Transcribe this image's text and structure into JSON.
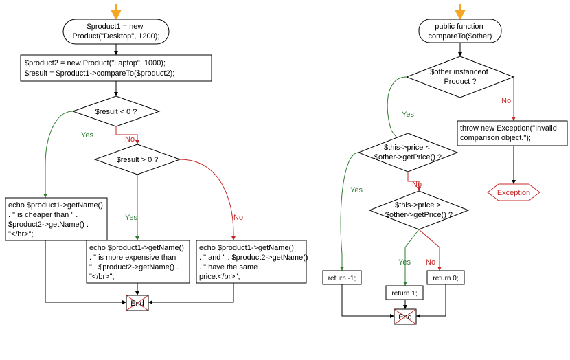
{
  "left": {
    "start": "$product1 = new\nProduct(\"Desktop\", 1200);",
    "init": "$product2 = new Product(\"Laptop\", 1000);\n$result = $product1->compareTo($product2);",
    "cond1": "$result < 0 ?",
    "cond2": "$result > 0 ?",
    "yes": "Yes",
    "no": "No",
    "branchA": "echo $product1->getName()\n. \" is cheaper than \" .\n$product2->getName() .\n\"</br>\";",
    "branchB": "echo $product1->getName()\n. \" is more expensive than\n\" . $product2->getName() .\n\"</br>\";",
    "branchC": "echo $product1->getName()\n. \" and \" . $product2->getName()\n. \" have the same\nprice.</br>\";",
    "end": "End"
  },
  "right": {
    "start": "public function\ncompareTo($other)",
    "cond1": "$other instanceof\nProduct ?",
    "cond2": "$this->price <\n$other->getPrice() ?",
    "cond3": "$this->price >\n$other->getPrice() ?",
    "yes": "Yes",
    "no": "No",
    "throw": "throw new Exception(\"Invalid\ncomparison object.\");",
    "exception": "Exception",
    "retNeg1": "return -1;",
    "ret1": "return 1;",
    "ret0": "return 0;",
    "end": "End"
  }
}
